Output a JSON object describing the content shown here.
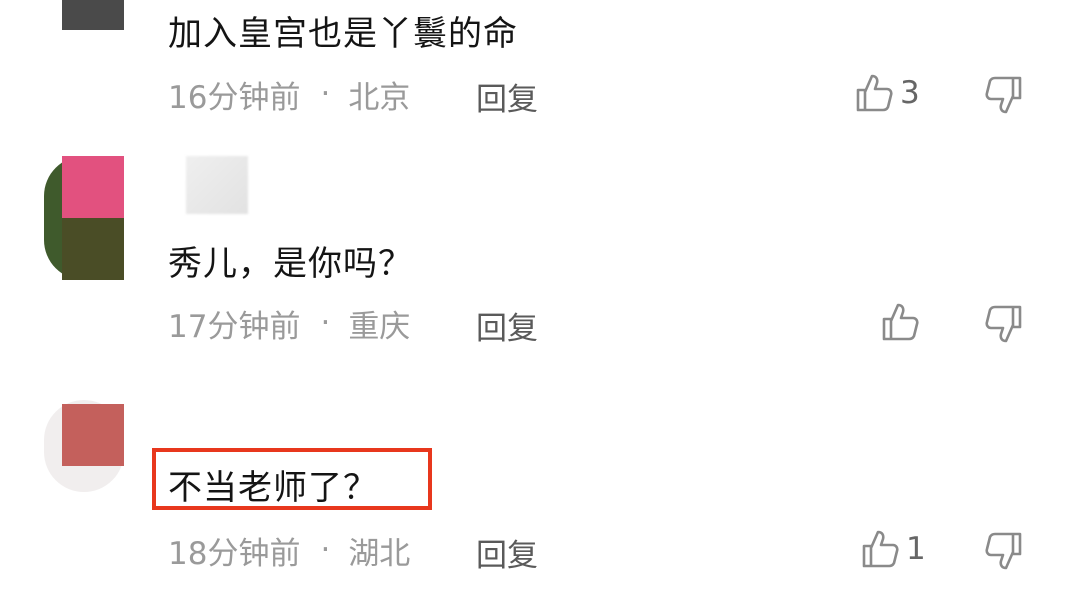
{
  "comments": [
    {
      "text": "加入皇宫也是丫鬟的命",
      "time": "16分钟前",
      "location": "北京",
      "reply_label": "回复",
      "likes": "3"
    },
    {
      "text": "秀儿，是你吗？",
      "time": "17分钟前",
      "location": "重庆",
      "reply_label": "回复",
      "likes": ""
    },
    {
      "text": "不当老师了？",
      "time": "18分钟前",
      "location": "湖北",
      "reply_label": "回复",
      "likes": "1"
    }
  ],
  "separator": "·",
  "colors": {
    "highlight": "#e8371d",
    "avatar1": "#4a4a4a",
    "avatar2_top": "#e2517f",
    "avatar2_bottom": "#4a4d26",
    "avatar3": "#c4605c"
  },
  "icons": {
    "like": "thumbs-up-icon",
    "dislike": "thumbs-down-icon"
  }
}
